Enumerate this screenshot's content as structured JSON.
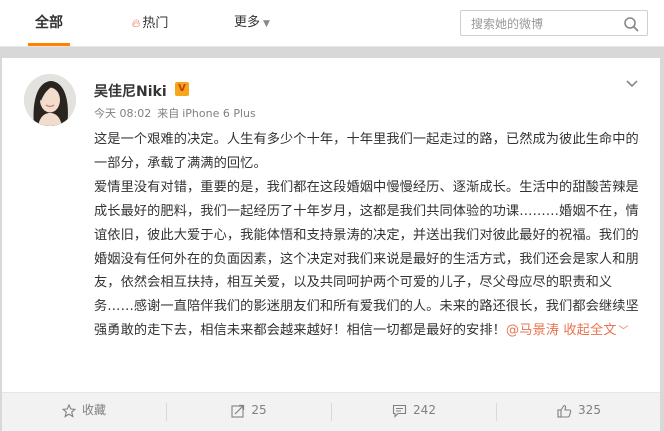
{
  "nav": {
    "tabs": [
      {
        "label": "全部",
        "active": true
      },
      {
        "label": "热门",
        "icon": "flame-icon"
      },
      {
        "label": "更多",
        "icon": "caret-down-icon"
      }
    ],
    "search_placeholder": "搜索她的微博"
  },
  "post": {
    "author": "吴佳尼Niki",
    "badge": "V",
    "time": "今天 08:02",
    "source_prefix": "来自",
    "source": "iPhone 6 Plus",
    "paragraphs": [
      "这是一个艰难的决定。人生有多少个十年，十年里我们一起走过的路，已然成为彼此生命中的一部分，承载了满满的回忆。",
      "爱情里没有对错，重要的是，我们都在这段婚姻中慢慢经历、逐渐成长。生活中的甜酸苦辣是成长最好的肥料，我们一起经历了十年岁月，这都是我们共同体验的功课………婚姻不在，情谊依旧，彼此大爱于心，我能体悟和支持景涛的决定，并送出我们对彼此最好的祝福。我们的婚姻没有任何外在的负面因素，这个决定对我们来说是最好的生活方式，我们还会是家人和朋友，依然会相互扶持，相互关爱，以及共同呵护两个可爱的儿子，尽父母应尽的职责和义务……感谢一直陪伴我们的影迷朋友们和所有爱我们的人。未来的路还很长，我们都会继续坚强勇敢的走下去，相信未来都会越来越好！相信一切都是最好的安排！"
    ],
    "mention": "@马景涛",
    "collapse_label": "收起全文"
  },
  "actions": {
    "favorite_label": "收藏",
    "repost_count": "25",
    "comment_count": "242",
    "like_count": "325"
  },
  "colors": {
    "accent": "#ff8200",
    "link": "#eb7350",
    "badge": "#f7a51c",
    "muted": "#808080"
  }
}
